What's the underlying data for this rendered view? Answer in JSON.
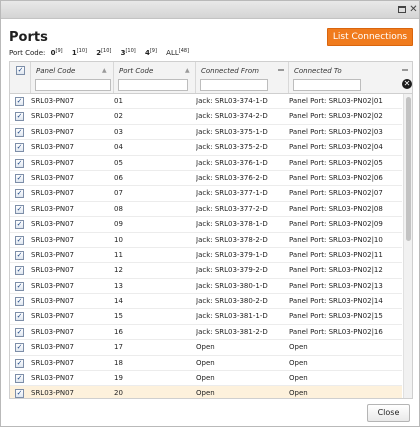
{
  "title": "Ports",
  "list_connections_label": "List Connections",
  "port_code_bar": {
    "label": "Port Code:",
    "links": [
      {
        "code": "0",
        "count": "[9]"
      },
      {
        "code": "1",
        "count": "[10]"
      },
      {
        "code": "2",
        "count": "[10]"
      },
      {
        "code": "3",
        "count": "[10]"
      },
      {
        "code": "4",
        "count": "[9]"
      },
      {
        "code": "ALL",
        "count": "[48]"
      }
    ]
  },
  "columns": {
    "panel_code": "Panel Code",
    "port_code": "Port Code",
    "connected_from": "Connected From",
    "connected_to": "Connected To"
  },
  "icons": {
    "checkbox": "check-icon",
    "sort": "sort-asc-icon",
    "filter_menu": "column-menu-icon",
    "clear": "clear-filter-icon",
    "maximize": "maximize-icon",
    "close": "close-icon"
  },
  "colors": {
    "accent": "#f07b1d",
    "selected_row": "#fdf1dc"
  },
  "rows": [
    {
      "panel": "SRL03-PN07",
      "port": "01",
      "from": "Jack: SRL03-374-1-D",
      "to": "Panel Port: SRL03-PN02|01",
      "checked": true
    },
    {
      "panel": "SRL03-PN07",
      "port": "02",
      "from": "Jack: SRL03-374-2-D",
      "to": "Panel Port: SRL03-PN02|02",
      "checked": true
    },
    {
      "panel": "SRL03-PN07",
      "port": "03",
      "from": "Jack: SRL03-375-1-D",
      "to": "Panel Port: SRL03-PN02|03",
      "checked": true
    },
    {
      "panel": "SRL03-PN07",
      "port": "04",
      "from": "Jack: SRL03-375-2-D",
      "to": "Panel Port: SRL03-PN02|04",
      "checked": true
    },
    {
      "panel": "SRL03-PN07",
      "port": "05",
      "from": "Jack: SRL03-376-1-D",
      "to": "Panel Port: SRL03-PN02|05",
      "checked": true
    },
    {
      "panel": "SRL03-PN07",
      "port": "06",
      "from": "Jack: SRL03-376-2-D",
      "to": "Panel Port: SRL03-PN02|06",
      "checked": true
    },
    {
      "panel": "SRL03-PN07",
      "port": "07",
      "from": "Jack: SRL03-377-1-D",
      "to": "Panel Port: SRL03-PN02|07",
      "checked": true
    },
    {
      "panel": "SRL03-PN07",
      "port": "08",
      "from": "Jack: SRL03-377-2-D",
      "to": "Panel Port: SRL03-PN02|08",
      "checked": true
    },
    {
      "panel": "SRL03-PN07",
      "port": "09",
      "from": "Jack: SRL03-378-1-D",
      "to": "Panel Port: SRL03-PN02|09",
      "checked": true
    },
    {
      "panel": "SRL03-PN07",
      "port": "10",
      "from": "Jack: SRL03-378-2-D",
      "to": "Panel Port: SRL03-PN02|10",
      "checked": true
    },
    {
      "panel": "SRL03-PN07",
      "port": "11",
      "from": "Jack: SRL03-379-1-D",
      "to": "Panel Port: SRL03-PN02|11",
      "checked": true
    },
    {
      "panel": "SRL03-PN07",
      "port": "12",
      "from": "Jack: SRL03-379-2-D",
      "to": "Panel Port: SRL03-PN02|12",
      "checked": true
    },
    {
      "panel": "SRL03-PN07",
      "port": "13",
      "from": "Jack: SRL03-380-1-D",
      "to": "Panel Port: SRL03-PN02|13",
      "checked": true
    },
    {
      "panel": "SRL03-PN07",
      "port": "14",
      "from": "Jack: SRL03-380-2-D",
      "to": "Panel Port: SRL03-PN02|14",
      "checked": true
    },
    {
      "panel": "SRL03-PN07",
      "port": "15",
      "from": "Jack: SRL03-381-1-D",
      "to": "Panel Port: SRL03-PN02|15",
      "checked": true
    },
    {
      "panel": "SRL03-PN07",
      "port": "16",
      "from": "Jack: SRL03-381-2-D",
      "to": "Panel Port: SRL03-PN02|16",
      "checked": true
    },
    {
      "panel": "SRL03-PN07",
      "port": "17",
      "from": "Open",
      "to": "Open",
      "checked": true
    },
    {
      "panel": "SRL03-PN07",
      "port": "18",
      "from": "Open",
      "to": "Open",
      "checked": true
    },
    {
      "panel": "SRL03-PN07",
      "port": "19",
      "from": "Open",
      "to": "Open",
      "checked": true
    },
    {
      "panel": "SRL03-PN07",
      "port": "20",
      "from": "Open",
      "to": "Open",
      "checked": true,
      "selected": true
    }
  ],
  "close_label": "Close"
}
